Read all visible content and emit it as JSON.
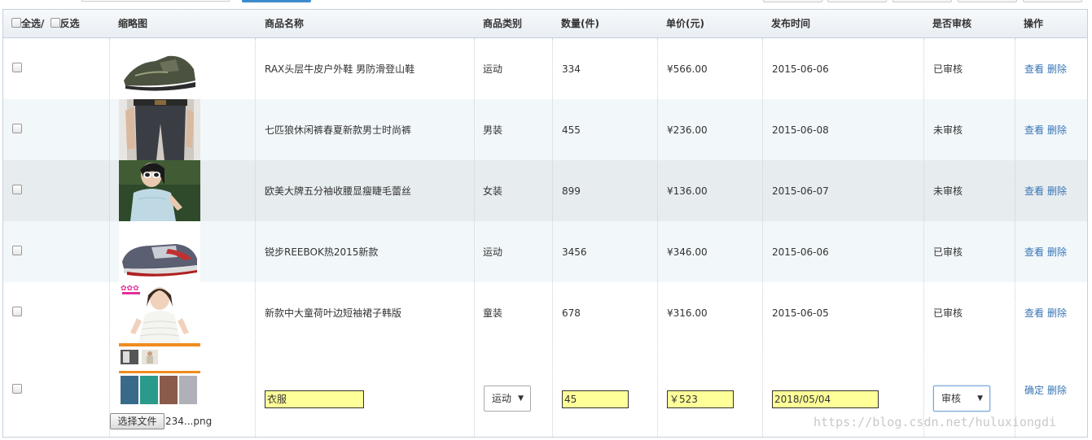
{
  "header": {
    "select_all": "全选/",
    "invert": "反选",
    "columns": [
      "缩略图",
      "商品名称",
      "商品类别",
      "数量(件)",
      "单价(元)",
      "发布时间",
      "是否审核",
      "操作"
    ]
  },
  "rows": [
    {
      "name": "RAX头层牛皮户外鞋 男防滑登山鞋",
      "category": "运动",
      "qty": "334",
      "price": "¥566.00",
      "date": "2015-06-06",
      "status": "已审核",
      "thumb": "hiking-shoe"
    },
    {
      "name": "七匹狼休闲裤春夏新款男士时尚裤",
      "category": "男装",
      "qty": "455",
      "price": "¥236.00",
      "date": "2015-06-08",
      "status": "未审核",
      "thumb": "mens-trousers"
    },
    {
      "name": "欧美大牌五分袖收腰显瘦睫毛蕾丝",
      "category": "女装",
      "qty": "899",
      "price": "¥136.00",
      "date": "2015-06-07",
      "status": "未审核",
      "thumb": "lace-top-model"
    },
    {
      "name": "锐步REEBOK热2015新款",
      "category": "运动",
      "qty": "3456",
      "price": "¥346.00",
      "date": "2015-06-06",
      "status": "已审核",
      "thumb": "reebok-sneaker"
    },
    {
      "name": "新款中大童荷叶边短袖裙子韩版",
      "category": "童装",
      "qty": "678",
      "price": "¥316.00",
      "date": "2015-06-05",
      "status": "已审核",
      "thumb": "kids-dress"
    }
  ],
  "actions": {
    "view": "查看",
    "delete": "删除",
    "confirm": "确定"
  },
  "edit_row": {
    "name": "衣服",
    "category": "运动",
    "qty": "45",
    "price": "￥523",
    "date": "2018/05/04",
    "status": "审核",
    "file_button": "选择文件",
    "file_name": "234...png",
    "thumb": "clothing-collage"
  },
  "watermark": "https://blog.csdn.net/huluxiongdi",
  "colors": {
    "link": "#3775b5",
    "input_bg": "#ffff99",
    "row_alt": "#f2f7fa",
    "row_alt2": "#e7ecef",
    "header_bg": "#e8eef3"
  }
}
